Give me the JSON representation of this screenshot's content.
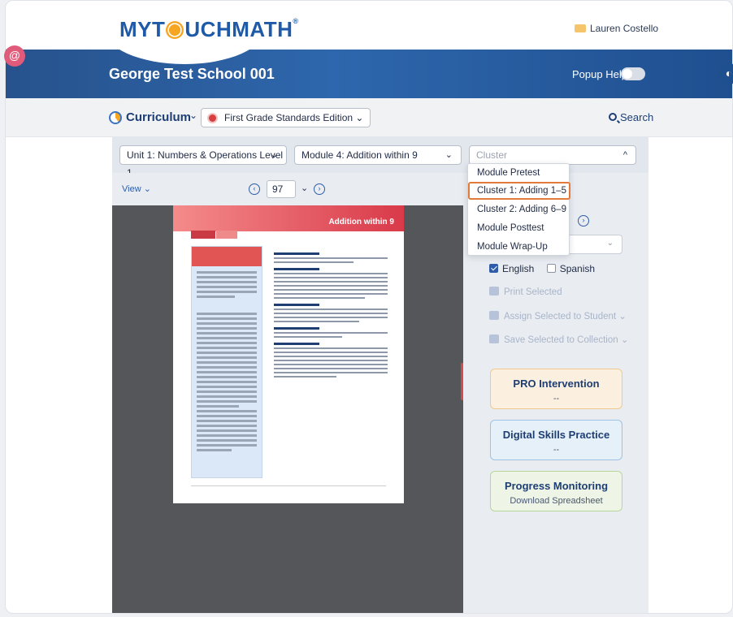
{
  "app": {
    "logo_text_pre": "MYT",
    "logo_text_post": "UCHMATH",
    "logo_reg": "®",
    "user_name": "Lauren Costello"
  },
  "banner": {
    "school_name": "George Test School 001",
    "popup_help_label": "Popup Help",
    "popup_help_on": false
  },
  "curriculum_bar": {
    "label": "Curriculum",
    "edition": "First Grade Standards Edition",
    "search_label": "Search"
  },
  "filters": {
    "unit": "Unit 1: Numbers & Operations Level 1",
    "module": "Module 4: Addition within 9",
    "cluster_placeholder": "Cluster"
  },
  "cluster_dropdown": {
    "options": [
      "Module Pretest",
      "Cluster 1: Adding 1–5",
      "Cluster 2: Adding 6–9",
      "Module Posttest",
      "Module Wrap-Up"
    ],
    "highlighted_index": 1
  },
  "viewer": {
    "view_label": "View",
    "page_number": "97",
    "page_title": "Addition within 9"
  },
  "panel": {
    "languages": [
      {
        "label": "English",
        "checked": true
      },
      {
        "label": "Spanish",
        "checked": false
      }
    ],
    "actions": {
      "print": "Print Selected",
      "assign": "Assign Selected to Student",
      "save": "Save Selected to Collection"
    },
    "cards": [
      {
        "title": "PRO Intervention",
        "subtitle": "--",
        "bg": "#fbf0df",
        "border": "#efc88f"
      },
      {
        "title": "Digital Skills Practice",
        "subtitle": "--",
        "bg": "#e6f0f8",
        "border": "#9fc2e2"
      },
      {
        "title": "Progress Monitoring",
        "subtitle": "Download Spreadsheet",
        "bg": "#eef5e6",
        "border": "#b9d69a"
      }
    ]
  },
  "colors": {
    "accent": "#2e5ca8",
    "brand_blue": "#1e3e74",
    "highlight": "#e27a3c"
  }
}
